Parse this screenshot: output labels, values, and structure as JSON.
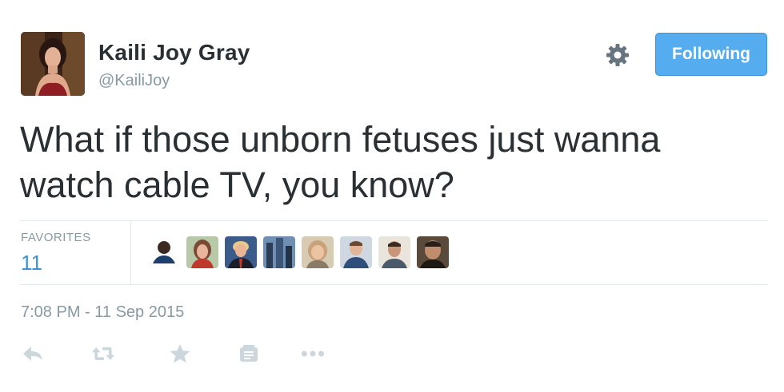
{
  "tweet": {
    "display_name": "Kaili Joy Gray",
    "screen_name": "@KailiJoy",
    "text_line1": "What if those unborn fetuses just wanna",
    "text_line2": "watch cable TV, you know?",
    "follow_label": "Following",
    "favorites_label": "FAVORITES",
    "favorites_count": "11",
    "timestamp": "7:08 PM - 11 Sep 2015"
  },
  "icons": {
    "settings": "gear-icon",
    "actions": [
      "reply-icon",
      "retweet-icon",
      "favorite-icon",
      "buffer-icon",
      "more-icon"
    ]
  },
  "colors": {
    "accent": "#55acee",
    "link": "#3b94d9",
    "muted": "#8899a6",
    "text": "#292f33",
    "action_icon": "#ccd6dd"
  },
  "favoriters_shown": 8
}
